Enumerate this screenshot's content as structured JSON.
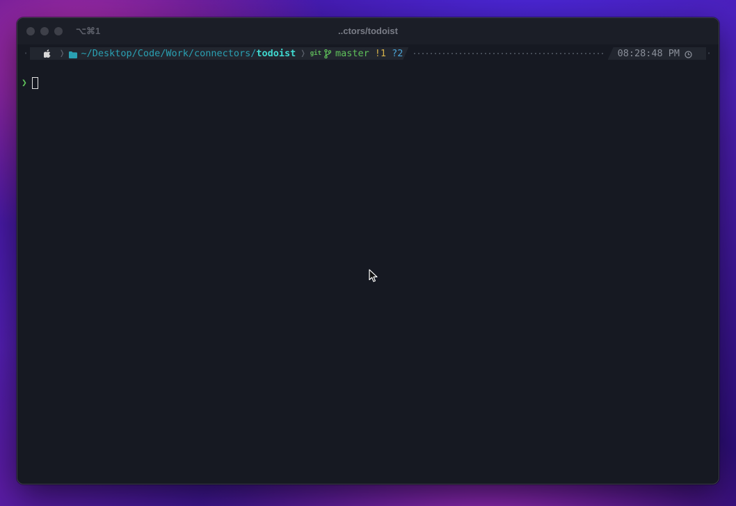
{
  "window": {
    "tab_shortcut": "⌥⌘1",
    "title": "..ctors/todoist"
  },
  "prompt": {
    "os_icon": "apple-icon",
    "folder_icon": "folder-icon",
    "path_prefix": "~/Desktop/Code/Work/connectors/",
    "path_current": "todoist",
    "git_label": "git",
    "branch_icon": "git-branch-icon",
    "branch": "master",
    "modified": "!1",
    "untracked": "?2",
    "time": "08:28:48 PM",
    "clock_icon": "clock-icon",
    "input_symbol": "❯",
    "input_value": ""
  },
  "colors": {
    "terminal_bg": "#161922",
    "path": "#2aa1b3",
    "branch": "#5fc25a",
    "modified": "#d6b24a",
    "untracked": "#4aa3d6"
  }
}
